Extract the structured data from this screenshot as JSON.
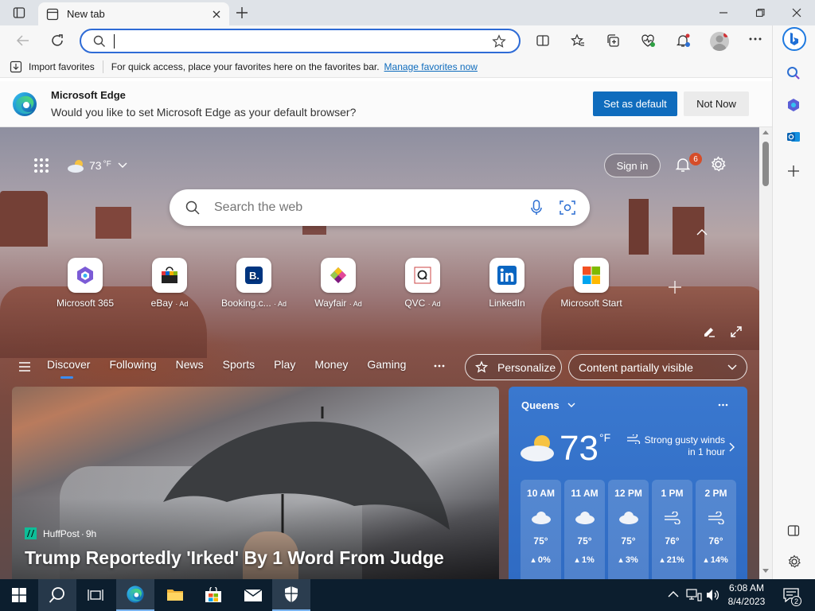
{
  "browser": {
    "tab_title": "New tab",
    "address_value": "",
    "bookmarks_bar": {
      "import_label": "Import favorites",
      "hint": "For quick access, place your favorites here on the favorites bar.",
      "manage_link": "Manage favorites now"
    }
  },
  "notification": {
    "title": "Microsoft Edge",
    "message": "Would you like to set Microsoft Edge as your default browser?",
    "primary": "Set as default",
    "secondary": "Not Now"
  },
  "newtab": {
    "weather_temp": "73",
    "weather_unit": "°F",
    "sign_in": "Sign in",
    "notifications_count": "6",
    "search_placeholder": "Search the web",
    "shortcuts": [
      {
        "label": "Microsoft 365"
      },
      {
        "label": "eBay",
        "ad": "· Ad"
      },
      {
        "label": "Booking.c...",
        "ad": "· Ad"
      },
      {
        "label": "Wayfair",
        "ad": "· Ad"
      },
      {
        "label": "QVC",
        "ad": "· Ad"
      },
      {
        "label": "LinkedIn"
      },
      {
        "label": "Microsoft Start"
      }
    ],
    "nav": [
      "Discover",
      "Following",
      "News",
      "Sports",
      "Play",
      "Money",
      "Gaming"
    ],
    "personalize": "Personalize",
    "content_filter": "Content partially visible"
  },
  "news": {
    "source": "HuffPost",
    "age": "9h",
    "headline": "Trump Reportedly 'Irked' By 1 Word From Judge"
  },
  "weather": {
    "location": "Queens",
    "temp": "73",
    "unit": "°F",
    "alert_line1": "Strong gusty winds",
    "alert_line2": "in 1 hour",
    "hours": [
      {
        "time": "10 AM",
        "temp": "75°",
        "precip": "0%",
        "icon": "cloud-icon"
      },
      {
        "time": "11 AM",
        "temp": "75°",
        "precip": "1%",
        "icon": "cloud-icon"
      },
      {
        "time": "12 PM",
        "temp": "75°",
        "precip": "3%",
        "icon": "cloud-icon"
      },
      {
        "time": "1 PM",
        "temp": "76°",
        "precip": "21%",
        "icon": "wind-icon"
      },
      {
        "time": "2 PM",
        "temp": "76°",
        "precip": "14%",
        "icon": "wind-icon"
      }
    ]
  },
  "taskbar": {
    "time": "6:08 AM",
    "date": "8/4/2023",
    "notification_count": "2"
  },
  "colors": {
    "accent": "#0f6cbd",
    "taskbar": "#0c1e2e",
    "weather": "#3a78cf"
  }
}
